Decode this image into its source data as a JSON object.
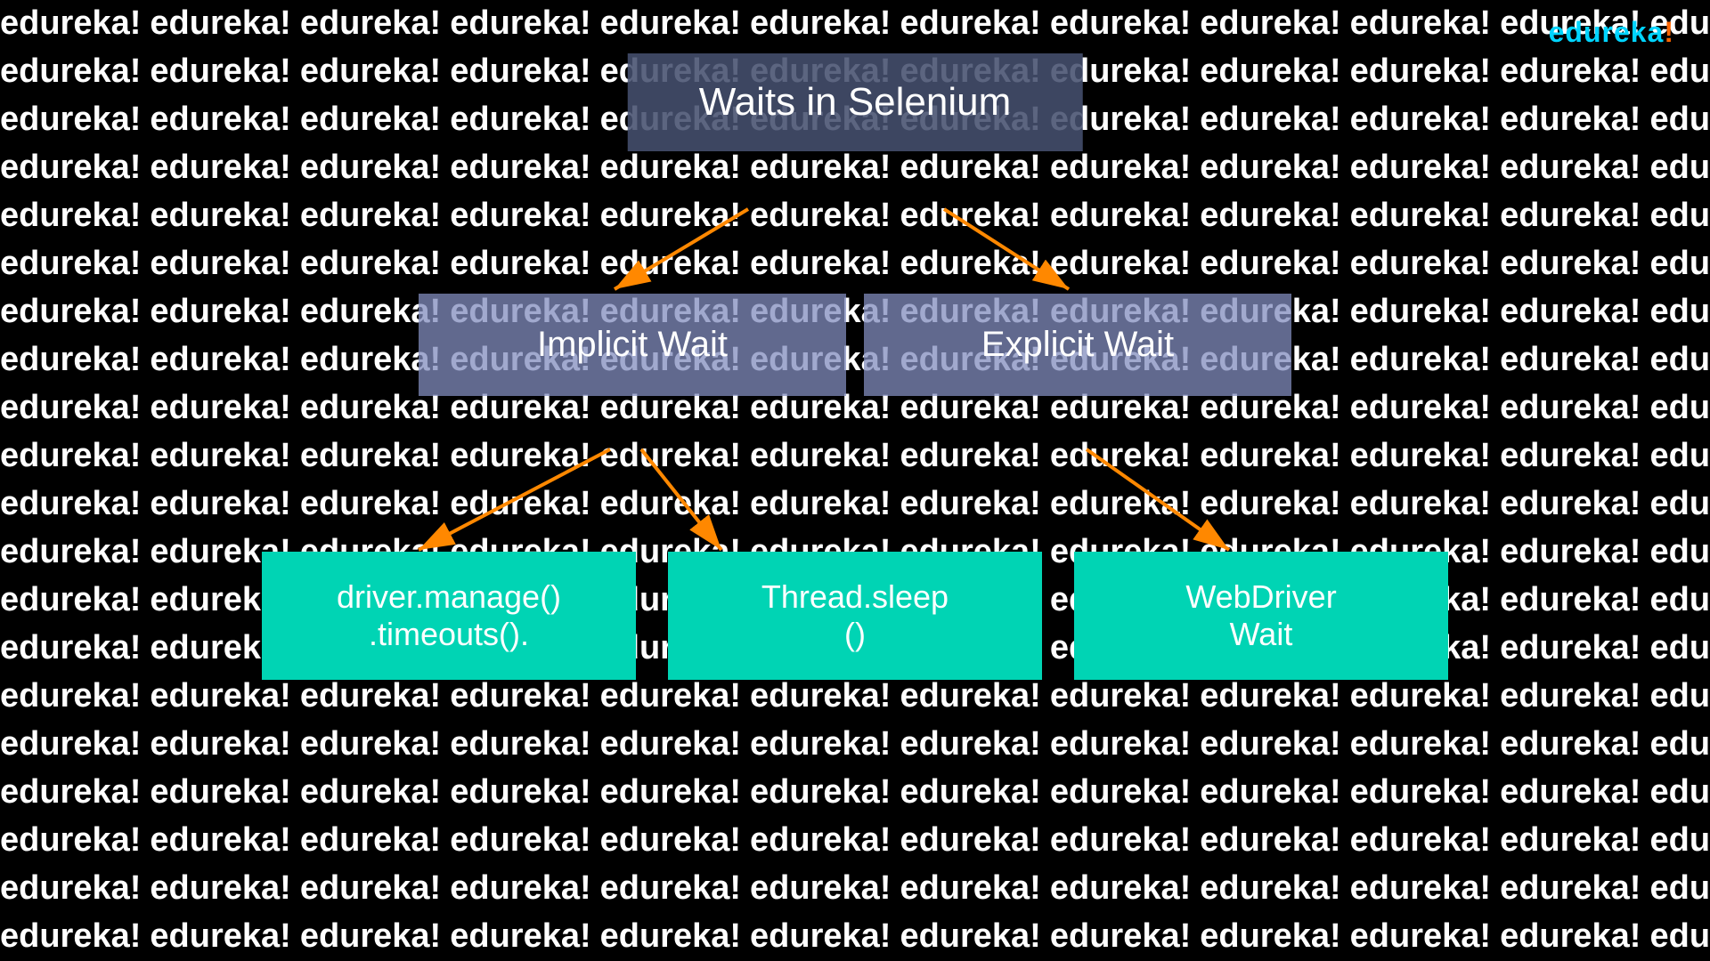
{
  "logo": {
    "text": "edureka",
    "exclaim": "!"
  },
  "title": {
    "line1": "Waits in Selenium"
  },
  "middle_boxes": [
    {
      "label": "Implicit Wait"
    },
    {
      "label": "Explicit Wait"
    }
  ],
  "bottom_boxes": [
    {
      "label": "driver.manage()\n.timeouts()."
    },
    {
      "label": "Thread.sleep\n()"
    },
    {
      "label": "WebDriver\nWait"
    }
  ],
  "bg_word": "edureka!",
  "arrows": {
    "color": "#ff8800",
    "stroke_width": 4
  }
}
